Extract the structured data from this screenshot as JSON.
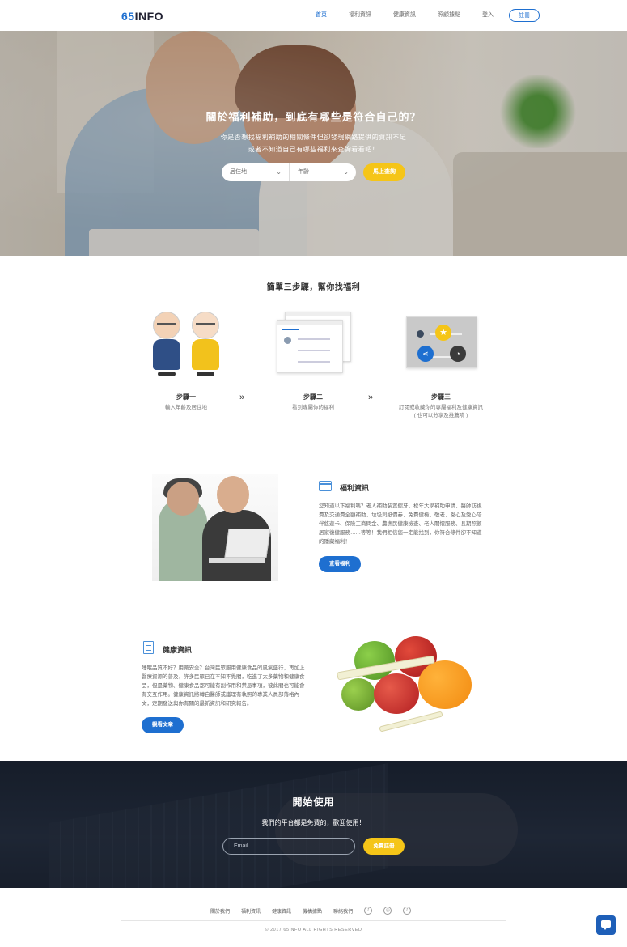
{
  "nav": {
    "logo_prefix": "65",
    "logo_suffix": "INFO",
    "items": [
      {
        "label": "首頁",
        "active": true
      },
      {
        "label": "福利資訊",
        "active": false
      },
      {
        "label": "健康資訊",
        "active": false
      },
      {
        "label": "照顧據點",
        "active": false
      },
      {
        "label": "登入",
        "active": false
      }
    ],
    "register_label": "註冊"
  },
  "hero": {
    "title": "關於福利補助，到底有哪些是符合自己的？",
    "subtitle_line1": "你是否想找福利補助的相關條件但卻發現網路提供的資訊不足",
    "subtitle_line2": "或者不知道自己有哪些福利來查詢看看吧！",
    "select_residence": "居住地",
    "select_age": "年齡",
    "search_button": "馬上查詢"
  },
  "steps": {
    "title": "簡單三步驟，幫你找福利",
    "items": [
      {
        "title": "步驟一",
        "desc": "輸入年齡及居住地"
      },
      {
        "title": "步驟二",
        "desc": "看到專屬你的福利"
      },
      {
        "title": "步驟三",
        "desc": "訂閱或收藏你的專屬福利及健康資訊",
        "desc2": "( 也可以分享及推薦唷 )"
      }
    ],
    "arrow": "»"
  },
  "welfare": {
    "title": "福利資訊",
    "body": "您知道以下福利嗎？老人補助裝置假牙、松年大學補助申請、醫師訪視費及交通費全額補助、垃圾與紙價券、免費健檢、敬老、愛心及愛心陪伴悠遊卡、保險工商問金、農漁民健康檢查、老人關懷服務、長期照顧居家復健服務……等等！我們相信您一定能找到，你符合條件卻不知道的隱藏福利！",
    "button": "查看福利"
  },
  "health": {
    "title": "健康資訊",
    "body": "睡眠品質不好？用藥安全？台灣民眾服用健康食品的風氣盛行，再加上醫療資源的普及，許多民眾已在不知不覺間，吃進了太多藥物和健康食品，但是藥物、健康食品都可能有副作用和禁忌事項，彼此間也可能會有交互作用。健康資訊將轉自醫師或護理有執照的專業人員部落格內文，定期發送與你有關的最新資訊和研究報告。",
    "button": "觀看文章"
  },
  "cta": {
    "title": "開始使用",
    "subtitle": "我們的平台都是免費的，歡迎使用！",
    "email_placeholder": "Email",
    "button": "免費註冊"
  },
  "footer": {
    "links": [
      "關於我們",
      "福利資訊",
      "健康資訊",
      "機構據點",
      "聯絡我們"
    ],
    "social_icons": [
      "facebook-icon",
      "instagram-icon",
      "twitter-icon"
    ],
    "copyright": "© 2017 65INFO ALL RIGHTS RESERVED"
  },
  "colors": {
    "brand_blue": "#1e6fd0",
    "accent_yellow": "#f5c518",
    "cta_dark": "#1c2533"
  }
}
